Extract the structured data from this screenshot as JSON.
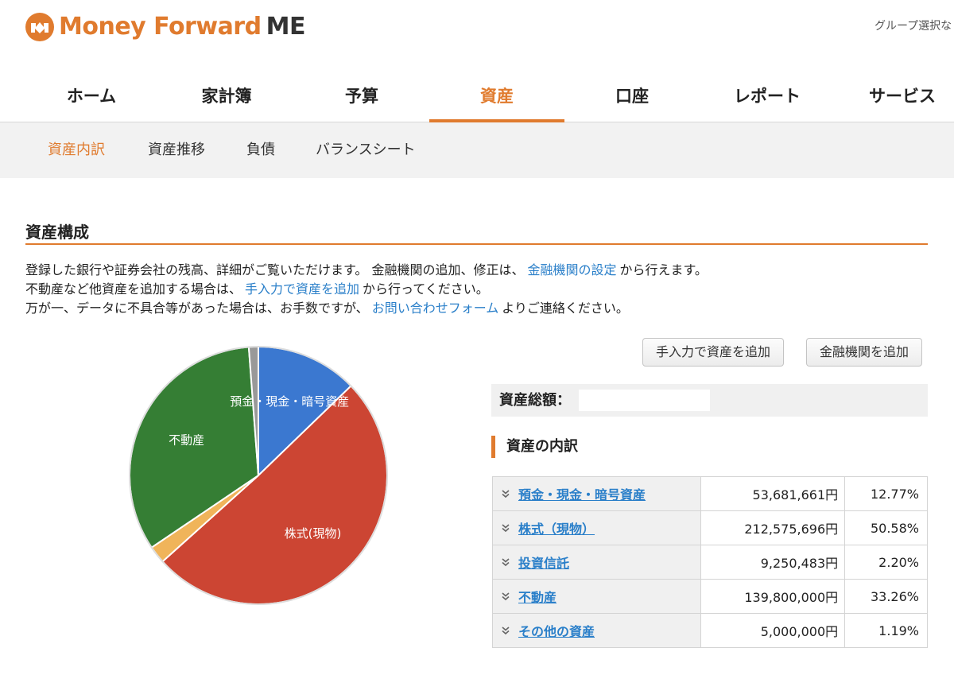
{
  "brand": {
    "name": "Money Forward",
    "suffix": "ME",
    "accent": "#e07b2e"
  },
  "header": {
    "group_select": "グループ選択な"
  },
  "global_nav": [
    {
      "label": "ホーム",
      "active": false
    },
    {
      "label": "家計簿",
      "active": false
    },
    {
      "label": "予算",
      "active": false
    },
    {
      "label": "資産",
      "active": true
    },
    {
      "label": "口座",
      "active": false
    },
    {
      "label": "レポート",
      "active": false
    },
    {
      "label": "サービス",
      "active": false
    }
  ],
  "sub_nav": [
    {
      "label": "資産内訳",
      "active": true
    },
    {
      "label": "資産推移",
      "active": false
    },
    {
      "label": "負債",
      "active": false
    },
    {
      "label": "バランスシート",
      "active": false
    }
  ],
  "section": {
    "title": "資産構成",
    "line1_a": "登録した銀行や証券会社の残高、詳細がご覧いただけます。 金融機関の追加、修正は、",
    "line1_link": "金融機関の設定",
    "line1_b": "から行えます。",
    "line2_a": "不動産など他資産を追加する場合は、",
    "line2_link": "手入力で資産を追加",
    "line2_b": "から行ってください。",
    "line3_a": "万が一、データに不具合等があった場合は、お手数ですが、",
    "line3_link": "お問い合わせフォーム",
    "line3_b": "よりご連絡ください。"
  },
  "buttons": {
    "manual_add": "手入力で資産を追加",
    "institution_add": "金融機関を追加"
  },
  "summary": {
    "total_label": "資産総額：",
    "total_value": ""
  },
  "breakdown": {
    "title": "資産の内訳",
    "rows": [
      {
        "category": "預金・現金・暗号資産",
        "amount": "53,681,661円",
        "percent": "12.77%"
      },
      {
        "category": "株式（現物）",
        "amount": "212,575,696円",
        "percent": "50.58%"
      },
      {
        "category": "投資信託",
        "amount": "9,250,483円",
        "percent": "2.20%"
      },
      {
        "category": "不動産",
        "amount": "139,800,000円",
        "percent": "33.26%"
      },
      {
        "category": "その他の資産",
        "amount": "5,000,000円",
        "percent": "1.19%"
      }
    ]
  },
  "chart_data": {
    "type": "pie",
    "slices": [
      {
        "label": "預金・現金・暗号資産",
        "value": 12.77,
        "color": "#3b78d0",
        "show_label": true
      },
      {
        "label": "株式(現物)",
        "value": 50.58,
        "color": "#cc4533",
        "show_label": true
      },
      {
        "label": "",
        "value": 2.2,
        "color": "#f0b45a",
        "show_label": false
      },
      {
        "label": "不動産",
        "value": 33.26,
        "color": "#357e34",
        "show_label": true
      },
      {
        "label": "",
        "value": 1.19,
        "color": "#999999",
        "show_label": false
      }
    ]
  }
}
